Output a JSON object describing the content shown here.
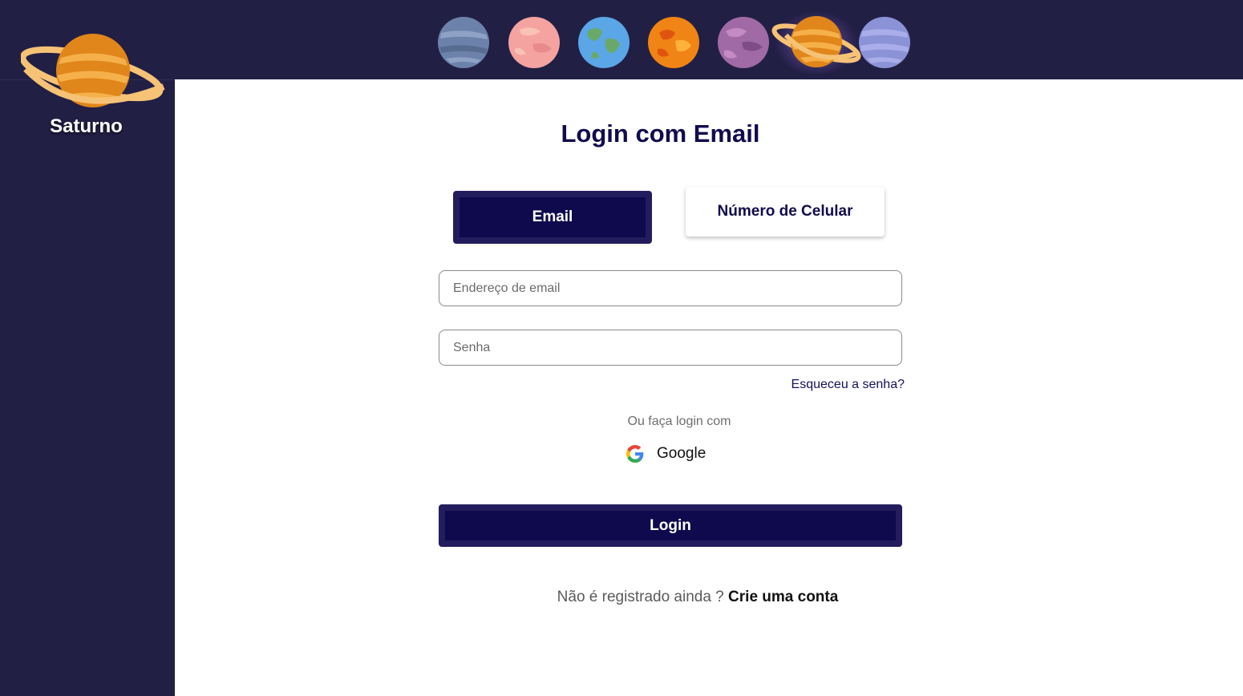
{
  "brand": {
    "name": "Saturno",
    "icon": "saturn-icon"
  },
  "planets": [
    {
      "name": "neptune-icon"
    },
    {
      "name": "venus-icon"
    },
    {
      "name": "earth-icon"
    },
    {
      "name": "mars-icon"
    },
    {
      "name": "jupiter-icon"
    },
    {
      "name": "saturn-icon",
      "active": true
    },
    {
      "name": "uranus-icon"
    }
  ],
  "login": {
    "title": "Login com Email",
    "tabs": [
      {
        "label": "Email",
        "active": true
      },
      {
        "label": "Número de Celular",
        "active": false
      }
    ],
    "email_placeholder": "Endereço de email",
    "password_placeholder": "Senha",
    "forgot": "Esqueceu a senha?",
    "or_text": "Ou faça login com",
    "google_label": "Google",
    "submit": "Login",
    "register_prompt": "Não é registrado ainda ?",
    "register_link": "Crie uma conta"
  },
  "colors": {
    "sidebar": "#221f45",
    "primary": "#0f0a4d",
    "primary_border": "#231d5e",
    "title": "#110b4e"
  }
}
